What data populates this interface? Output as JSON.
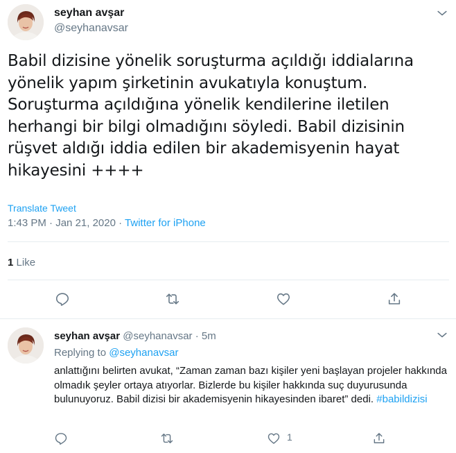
{
  "main_tweet": {
    "author_name": "seyhan avşar",
    "author_handle": "@seyhanavsar",
    "text": "Babil dizisine yönelik soruşturma açıldığı iddialarına yönelik yapım şirketinin avukatıyla konuştum. Soruşturma açıldığına yönelik kendilerine iletilen herhangi bir bilgi olmadığını söyledi. Babil dizisinin rüşvet aldığı iddia edilen bir akademisyenin hayat hikayesini ++++",
    "translate_label": "Translate Tweet",
    "time": "1:43 PM",
    "separator": "·",
    "date": "Jan 21, 2020",
    "source": "Twitter for iPhone",
    "like_count": "1",
    "like_label": "Like"
  },
  "reply_tweet": {
    "author_name": "seyhan avşar",
    "author_handle": "@seyhanavsar",
    "separator": "·",
    "time_ago": "5m",
    "replying_prefix": "Replying to",
    "replying_to": "@seyhanavsar",
    "text": "anlattığını belirten avukat, “Zaman zaman bazı kişiler yeni başlayan projeler hakkında olmadık şeyler ortaya atıyorlar. Bizlerde bu kişiler hakkında suç duyurusunda bulunuyoruz. Babil dizisi bir akademisyenin hikayesinden ibaret” dedi.",
    "hashtag": "#babildizisi",
    "like_count": "1"
  },
  "icons": {
    "reply": "reply-icon",
    "retweet": "retweet-icon",
    "like": "heart-icon",
    "share": "share-icon",
    "more": "chevron-down-icon"
  },
  "colors": {
    "accent": "#1da1f2",
    "secondary_text": "#657786",
    "primary_text": "#14171a",
    "divider": "#e6ecf0"
  }
}
